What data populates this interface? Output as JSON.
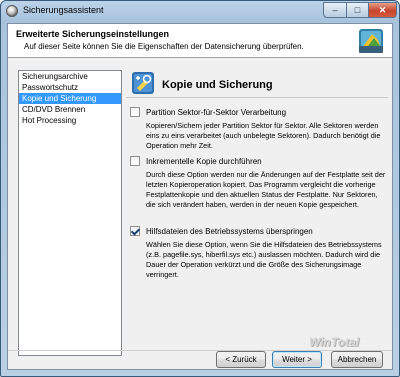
{
  "window": {
    "title": "Sicherungsassistent"
  },
  "header": {
    "title": "Erweiterte Sicherungseinstellungen",
    "subtitle": "Auf dieser Seite können Sie die Eigenschaften der Datensicherung überprüfen."
  },
  "nav": {
    "items": [
      {
        "label": "Sicherungsarchive"
      },
      {
        "label": "Passwortschutz"
      },
      {
        "label": "Kopie und Sicherung"
      },
      {
        "label": "CD/DVD Brennen"
      },
      {
        "label": "Hot Processing"
      }
    ],
    "selected_index": 2
  },
  "section": {
    "title": "Kopie und Sicherung"
  },
  "options": [
    {
      "label": "Partition Sektor-für-Sektor Verarbeitung",
      "checked": false,
      "description": "Kopieren/Sichern jeder Partition Sektor für Sektor. Alle Sektoren werden eins zu eins verarbeitet (auch unbelegte Sektoren). Dadurch benötigt die Operation mehr Zeit."
    },
    {
      "label": "Inkrementelle Kopie durchführen",
      "checked": false,
      "description": "Durch diese Option werden nur die Änderungen auf der Festplatte seit der letzten Kopieroperation kopiert. Das Programm vergleicht die vorherige Festplattenkopie und den aktuellen Status der Festplatte. Nur Sektoren, die sich verändert haben, werden in der neuen Kopie gespeichert."
    },
    {
      "label": "Hilfsdateien des Betriebssystems überspringen",
      "checked": true,
      "description": "Wählen Sie diese Option, wenn Sie die Hilfsdateien des Betriebssystems (z.B. pagefile.sys, hiberfil.sys etc.) auslassen möchten. Dadurch wird die Dauer der Operation verkürzt und die Größe des Sicherungsimage verringert."
    }
  ],
  "watermark": "WinTotal",
  "buttons": {
    "back": "< Zurück",
    "next": "Weiter >",
    "cancel": "Abbrechen"
  },
  "colors": {
    "selection": "#3399ff",
    "close_button": "#c6452c",
    "client_background": "#f0f0f0"
  }
}
